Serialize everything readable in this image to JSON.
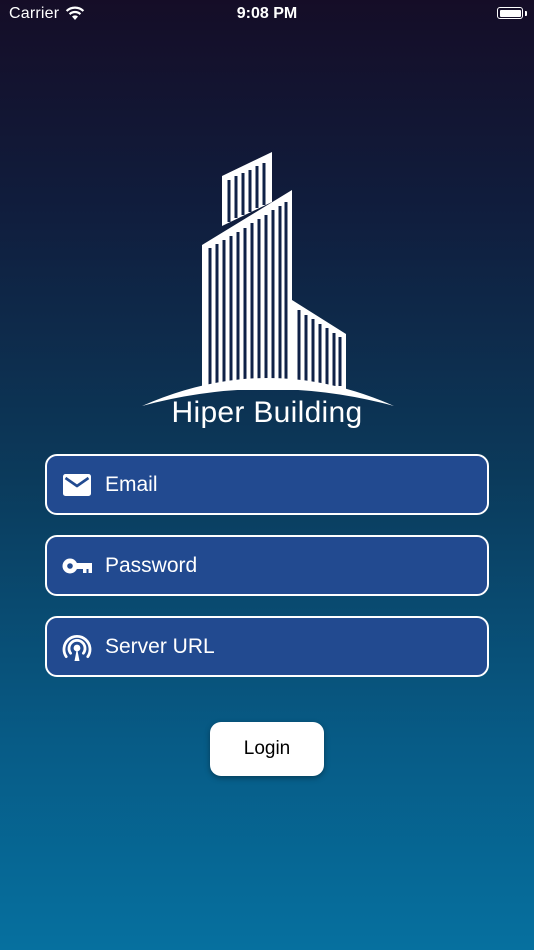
{
  "status_bar": {
    "carrier": "Carrier",
    "time": "9:08 PM",
    "wifi_icon": "wifi-icon",
    "battery_icon": "battery-icon"
  },
  "logo": {
    "icon": "building-logo-icon",
    "brand_name": "Hiper Building"
  },
  "form": {
    "email": {
      "placeholder": "Email",
      "value": "",
      "icon": "mail-icon"
    },
    "password": {
      "placeholder": "Password",
      "value": "",
      "icon": "key-icon"
    },
    "server_url": {
      "placeholder": "Server URL",
      "value": "",
      "icon": "broadcast-icon"
    },
    "login_label": "Login"
  },
  "colors": {
    "field_fill": "#224a90",
    "field_border": "#ffffff",
    "gradient_top": "#150d27",
    "gradient_bottom": "#06709f",
    "button_fill": "#ffffff"
  }
}
